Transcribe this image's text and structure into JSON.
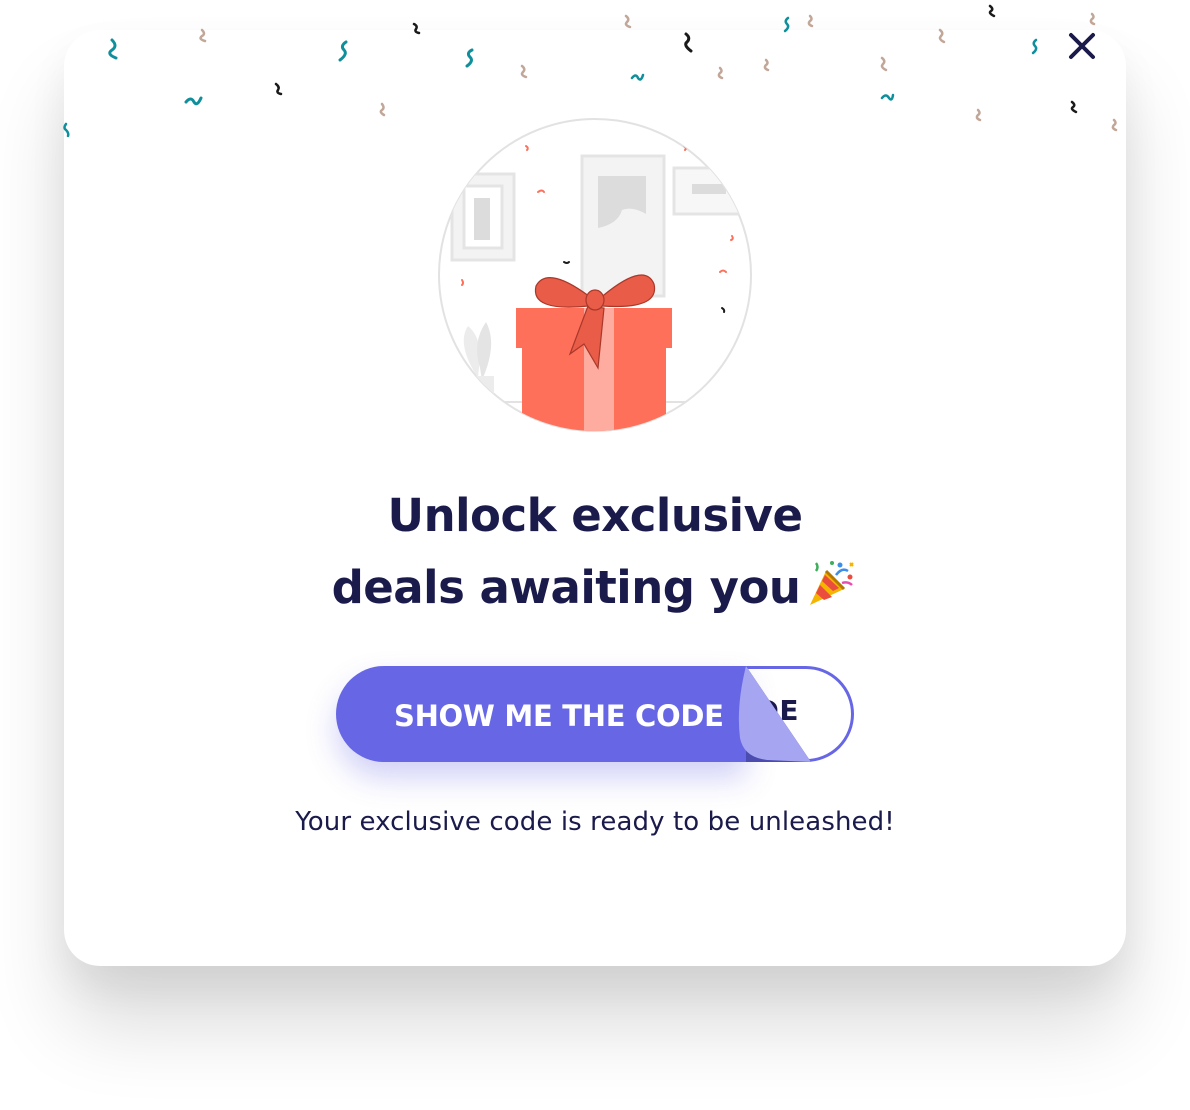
{
  "modal": {
    "headline_line1": "Unlock exclusive",
    "headline_line2": "deals awaiting you",
    "headline_emoji_icon": "party-popper-icon",
    "reveal_button_label": "SHOW ME THE CODE",
    "code_peek_text": "DE",
    "subtext": "Your exclusive code is ready to be unleashed!",
    "close_icon": "close-icon",
    "illustration_icon": "gift-box-icon"
  },
  "colors": {
    "primary": "#6767e6",
    "primary_light": "#a5a5f2",
    "primary_dark": "#4b4bb0",
    "heading": "#1a1a4b",
    "gift_red": "#ff705a",
    "gift_ribbon": "#e85c48",
    "confetti_teal": "#0f8f9c",
    "confetti_tan": "#c2a698",
    "confetti_dark": "#1a1a1a"
  }
}
